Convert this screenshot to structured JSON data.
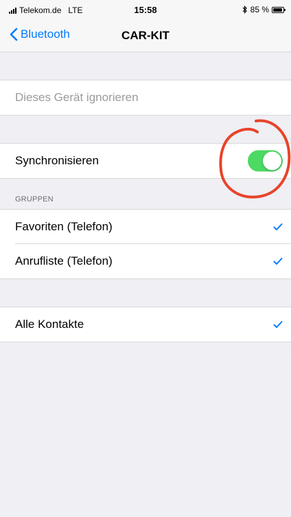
{
  "status_bar": {
    "carrier": "Telekom.de",
    "network": "LTE",
    "time": "15:58",
    "battery_percent": "85 %",
    "battery_level": 0.85
  },
  "nav": {
    "back_label": "Bluetooth",
    "title": "CAR-KIT"
  },
  "actions": {
    "ignore_device_label": "Dieses Gerät ignorieren"
  },
  "sync": {
    "label": "Synchronisieren",
    "enabled": true,
    "toggle_color": "#4cd964"
  },
  "groups": {
    "header": "GRUPPEN",
    "items": [
      {
        "label": "Favoriten (Telefon)",
        "checked": true
      },
      {
        "label": "Anrufliste (Telefon)",
        "checked": true
      }
    ]
  },
  "contacts": {
    "label": "Alle Kontakte",
    "checked": true
  },
  "colors": {
    "accent": "#007aff",
    "annotation": "#e8442a"
  }
}
